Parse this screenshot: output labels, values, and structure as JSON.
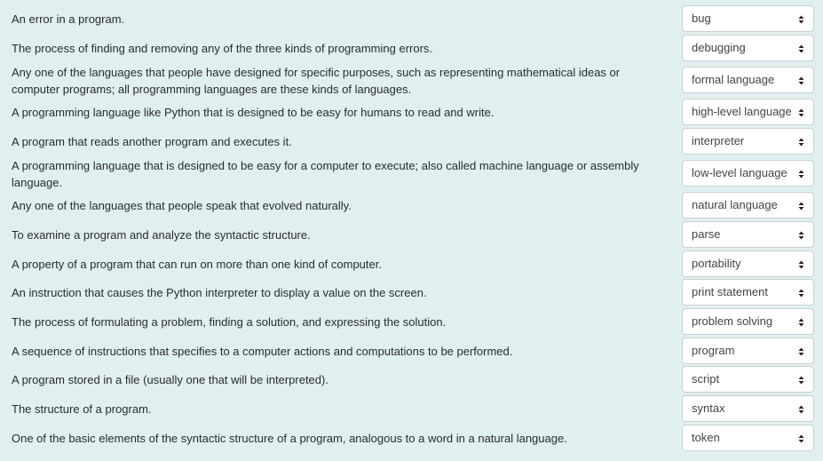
{
  "items": [
    {
      "definition": "An error in a program.",
      "answer": "bug"
    },
    {
      "definition": "The process of finding and removing any of the three kinds of programming errors.",
      "answer": "debugging"
    },
    {
      "definition": "Any one of the languages that people have designed for specific purposes, such as representing mathematical ideas or computer programs; all programming languages are these kinds of languages.",
      "answer": "formal language"
    },
    {
      "definition": "A programming language like Python that is designed to be easy for humans to read and write.",
      "answer": "high-level language"
    },
    {
      "definition": "A program that reads another program and executes it.",
      "answer": "interpreter"
    },
    {
      "definition": "A programming language that is designed to be easy for a computer to execute; also called machine language or assembly language.",
      "answer": "low-level language"
    },
    {
      "definition": "Any one of the languages that people speak that evolved naturally.",
      "answer": "natural language"
    },
    {
      "definition": "To examine a program and analyze the syntactic structure.",
      "answer": "parse"
    },
    {
      "definition": "A property of a program that can run on more than one kind of computer.",
      "answer": "portability"
    },
    {
      "definition": "An instruction that causes the Python interpreter to display a value on the screen.",
      "answer": "print statement"
    },
    {
      "definition": "The process of formulating a problem, finding a solution, and expressing the solution.",
      "answer": "problem solving"
    },
    {
      "definition": "A sequence of instructions that specifies to a computer actions and computations to be performed.",
      "answer": "program"
    },
    {
      "definition": "A program stored in a file (usually one that will be interpreted).",
      "answer": "script"
    },
    {
      "definition": "The structure of a program.",
      "answer": "syntax"
    },
    {
      "definition": "One of the basic elements of the syntactic structure of a program, analogous to a word in a natural language.",
      "answer": "token"
    }
  ],
  "icons": {
    "select_arrow": "up-down-chevron-icon"
  }
}
